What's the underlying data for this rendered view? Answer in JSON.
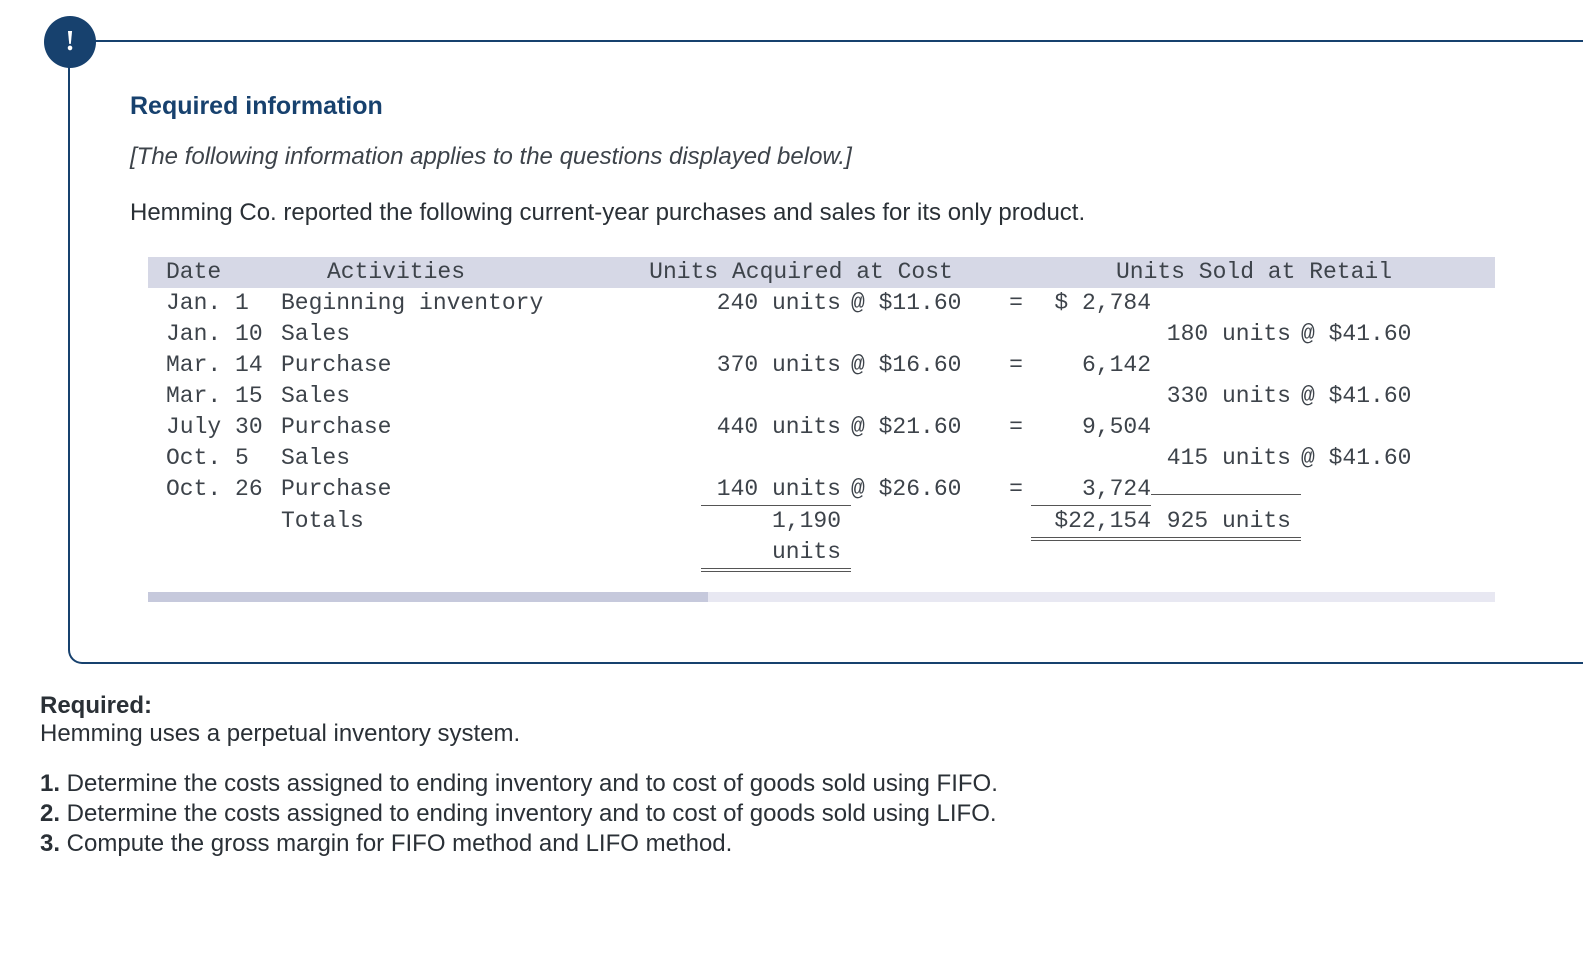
{
  "badge_glyph": "!",
  "section_title": "Required information",
  "note": "[The following information applies to the questions displayed below.]",
  "intro": "Hemming Co. reported the following current-year purchases and sales for its only product.",
  "table": {
    "headers": {
      "date": "Date",
      "activities": "Activities",
      "acquired": "Units Acquired at Cost",
      "sold": "Units Sold at Retail"
    },
    "rows": [
      {
        "date": "Jan.  1",
        "act": "Beginning inventory",
        "units": "240 units",
        "at": "@ $11.60",
        "eq": "=",
        "cost": "$ 2,784",
        "su": "",
        "sp": ""
      },
      {
        "date": "Jan. 10",
        "act": "Sales",
        "units": "",
        "at": "",
        "eq": "",
        "cost": "",
        "su": "180 units",
        "sp": "@ $41.60"
      },
      {
        "date": "Mar. 14",
        "act": "Purchase",
        "units": "370 units",
        "at": "@ $16.60",
        "eq": "=",
        "cost": "6,142",
        "su": "",
        "sp": ""
      },
      {
        "date": "Mar. 15",
        "act": "Sales",
        "units": "",
        "at": "",
        "eq": "",
        "cost": "",
        "su": "330 units",
        "sp": "@ $41.60"
      },
      {
        "date": "July 30",
        "act": "Purchase",
        "units": "440 units",
        "at": "@ $21.60",
        "eq": "=",
        "cost": "9,504",
        "su": "",
        "sp": ""
      },
      {
        "date": "Oct.  5",
        "act": "Sales",
        "units": "",
        "at": "",
        "eq": "",
        "cost": "",
        "su": "415 units",
        "sp": "@ $41.60"
      },
      {
        "date": "Oct. 26",
        "act": "Purchase",
        "units": "140 units",
        "at": "@ $26.60",
        "eq": "=",
        "cost": "3,724",
        "su": "",
        "sp": ""
      }
    ],
    "totals": {
      "label": "Totals",
      "units": "1,190 units",
      "cost": "$22,154",
      "sold": "925 units"
    }
  },
  "required": {
    "title": "Required:",
    "intro": "Hemming uses a perpetual inventory system.",
    "items": [
      {
        "num": "1.",
        "text": " Determine the costs assigned to ending inventory and to cost of goods sold using FIFO."
      },
      {
        "num": "2.",
        "text": " Determine the costs assigned to ending inventory and to cost of goods sold using LIFO."
      },
      {
        "num": "3.",
        "text": " Compute the gross margin for FIFO method and LIFO method."
      }
    ]
  }
}
